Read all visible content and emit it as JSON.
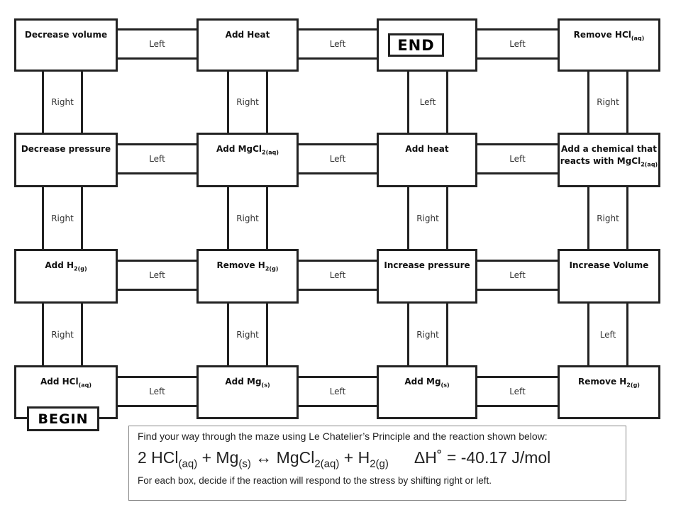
{
  "boxes": {
    "r1c1": {
      "text": "Decrease volume",
      "sub": ""
    },
    "r1c2": {
      "text": "Add Heat",
      "sub": ""
    },
    "r1c3": {
      "text": "",
      "sub": ""
    },
    "r1c4": {
      "text": "Remove HCl",
      "sub": "(aq)"
    },
    "r2c1": {
      "text": "Decrease pressure",
      "sub": ""
    },
    "r2c2": {
      "text": "Add MgCl",
      "sub": "2(aq)"
    },
    "r2c3": {
      "text": "Add heat",
      "sub": ""
    },
    "r2c4": {
      "text": "Add a chemical that reacts with MgCl",
      "sub": "2(aq)"
    },
    "r3c1": {
      "text": "Add H",
      "sub": "2(g)"
    },
    "r3c2": {
      "text": "Remove H",
      "sub": "2(g)"
    },
    "r3c3": {
      "text": "Increase pressure",
      "sub": ""
    },
    "r3c4": {
      "text": "Increase Volume",
      "sub": ""
    },
    "r4c1": {
      "text": "Add HCl",
      "sub": "(aq)"
    },
    "r4c2": {
      "text": "Add Mg",
      "sub": "(s)"
    },
    "r4c3": {
      "text": "Add Mg",
      "sub": "(s)"
    },
    "r4c4": {
      "text": "Remove H",
      "sub": "2(g)"
    }
  },
  "end_label": "END",
  "begin_label": "BEGIN",
  "horizontal": {
    "r1": [
      "Left",
      "Left",
      "Left"
    ],
    "r2": [
      "Left",
      "Left",
      "Left"
    ],
    "r3": [
      "Left",
      "Left",
      "Left"
    ],
    "r4": [
      "Left",
      "Left",
      "Left"
    ]
  },
  "vertical": {
    "r1": [
      "Right",
      "Right",
      "Left",
      "Right"
    ],
    "r2": [
      "Right",
      "Right",
      "Right",
      "Right"
    ],
    "r3": [
      "Right",
      "Right",
      "Right",
      "Left"
    ]
  },
  "info": {
    "line1": "Find your way through the maze using Le Chatelier’s Principle and the reaction shown below:",
    "eq": {
      "a": "2 HCl",
      "a_sub": "(aq)",
      "b": " + Mg",
      "b_sub": "(s)",
      "c": " ↔ MgCl",
      "c_sub": "2(aq)",
      "d": " + H",
      "d_sub": "2(g)",
      "dh": "ΔH˚ = -40.17 J/mol"
    },
    "line3": "For each box, decide if the reaction will respond to the stress by shifting right or left."
  }
}
